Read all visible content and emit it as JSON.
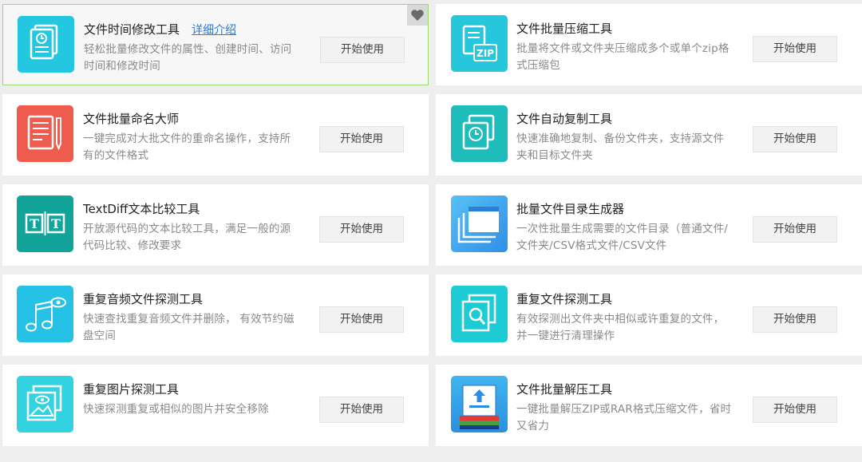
{
  "tools": [
    {
      "title": "文件时间修改工具",
      "link": "详细介绍",
      "desc": "轻松批量修改文件的属性、创建时间、访问时间和修改时间",
      "button": "开始使用",
      "icon": "document-clock-icon",
      "color": "#23c7e0",
      "highlight": true
    },
    {
      "title": "文件批量压缩工具",
      "desc": "批量将文件或文件夹压缩成多个或单个zip格式压缩包",
      "button": "开始使用",
      "icon": "zip-document-icon",
      "color": "#26c6dc"
    },
    {
      "title": "文件批量命名大师",
      "desc": "一键完成对大批文件的重命名操作，支持所有的文件格式",
      "button": "开始使用",
      "icon": "document-pen-icon",
      "color": "#ef5b4c"
    },
    {
      "title": "文件自动复制工具",
      "desc": "快速准确地复制、备份文件夹，支持源文件夹和目标文件夹",
      "button": "开始使用",
      "icon": "copy-clock-icon",
      "color": "#1fbcbc"
    },
    {
      "title": "TextDiff文本比较工具",
      "desc": "开放源代码的文本比较工具，满足一般的源代码比较、修改要求",
      "button": "开始使用",
      "icon": "text-compare-icon",
      "color": "#12a39a"
    },
    {
      "title": "批量文件目录生成器",
      "desc": "一次性批量生成需要的文件目录（普通文件/文件夹/CSV格式文件/CSV文件",
      "button": "开始使用",
      "icon": "folder-stack-icon",
      "color": "#3aa0ec"
    },
    {
      "title": "重复音频文件探测工具",
      "desc": "快速查找重复音频文件并删除， 有效节约磁盘空间",
      "button": "开始使用",
      "icon": "music-notes-eye-icon",
      "color": "#26c2e6"
    },
    {
      "title": "重复文件探测工具",
      "desc": "有效探测出文件夹中相似或许重复的文件，并一键进行清理操作",
      "button": "开始使用",
      "icon": "file-search-icon",
      "color": "#1ccbd4"
    },
    {
      "title": "重复图片探测工具",
      "desc": "快速探测重复或相似的图片并安全移除",
      "button": "开始使用",
      "icon": "picture-eye-icon",
      "color": "#32d2e0"
    },
    {
      "title": "文件批量解压工具",
      "desc": "一键批量解压ZIP或RAR格式压缩文件，省时又省力",
      "button": "开始使用",
      "icon": "archive-extract-icon",
      "color": "#27a4e8"
    }
  ],
  "favorite_icon": "heart-icon"
}
